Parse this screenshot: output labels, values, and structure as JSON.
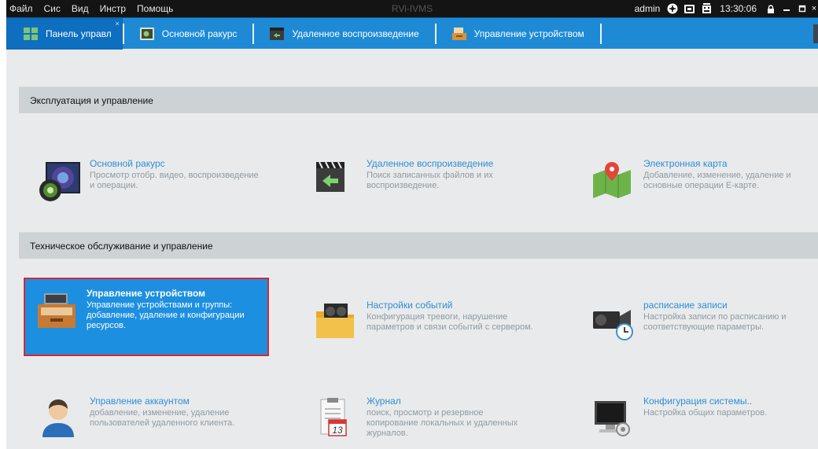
{
  "window": {
    "title": "RVi-IVMS"
  },
  "menu": {
    "items": [
      "Файл",
      "Сис",
      "Вид",
      "Инстр",
      "Помощь"
    ]
  },
  "statusbar": {
    "user": "admin",
    "time": "13:30:06",
    "close_glyph": "×"
  },
  "tabs": [
    {
      "label": "Панель управл",
      "icon": "dashboard-icon",
      "close": "×"
    },
    {
      "label": "Основной ракурс",
      "icon": "main-view-icon"
    },
    {
      "label": "Удаленное воспроизведение",
      "icon": "remote-playback-icon"
    },
    {
      "label": "Управление устройством",
      "icon": "device-management-icon"
    }
  ],
  "sections": [
    {
      "title": "Эксплуатация и управление"
    },
    {
      "title": "Техническое обслуживание и управление"
    }
  ],
  "tiles": [
    {
      "title": "Основной ракурс",
      "desc": "Просмотр отобр. видео, воспроизведение и операции.",
      "icon": "camera-lens-icon"
    },
    {
      "title": "Удаленное воспроизведение",
      "desc": "Поиск записанных файлов и их воспроизведение.",
      "icon": "clapperboard-replay-icon"
    },
    {
      "title": "Электронная карта",
      "desc": "Добавление, изменение, удаление и основные операции E-карте.",
      "icon": "map-pin-icon"
    },
    {
      "title": "Управление устройством",
      "desc": "Управление устройствами и группы: добавление, удаление и конфигурации ресурсов.",
      "icon": "device-drawer-icon",
      "selected": true
    },
    {
      "title": "Настройки событий",
      "desc": "Конфигурация тревоги, нарушение параметров и связи событий с сервером.",
      "icon": "event-folder-icon"
    },
    {
      "title": "расписание записи",
      "desc": "Настройка записи по расписанию и соответствующие параметры.",
      "icon": "camcorder-clock-icon"
    },
    {
      "title": "Управление аккаунтом",
      "desc": "добавление, изменение, удаление пользователей удаленного клиента.",
      "icon": "user-account-icon"
    },
    {
      "title": "Журнал",
      "desc": "поиск, просмотр и резервное копирование локальных и удаленных журналов.",
      "icon": "log-calendar-icon",
      "calendar_day": "13"
    },
    {
      "title": "Конфигурация системы..",
      "desc": "Настройка общих параметров.",
      "icon": "system-config-icon"
    }
  ],
  "colors": {
    "accent": "#1e8ad6",
    "selection": "#1d8fe0",
    "selection_border": "#e1232b",
    "link": "#2b8fd8",
    "muted": "#8e9ba3"
  }
}
